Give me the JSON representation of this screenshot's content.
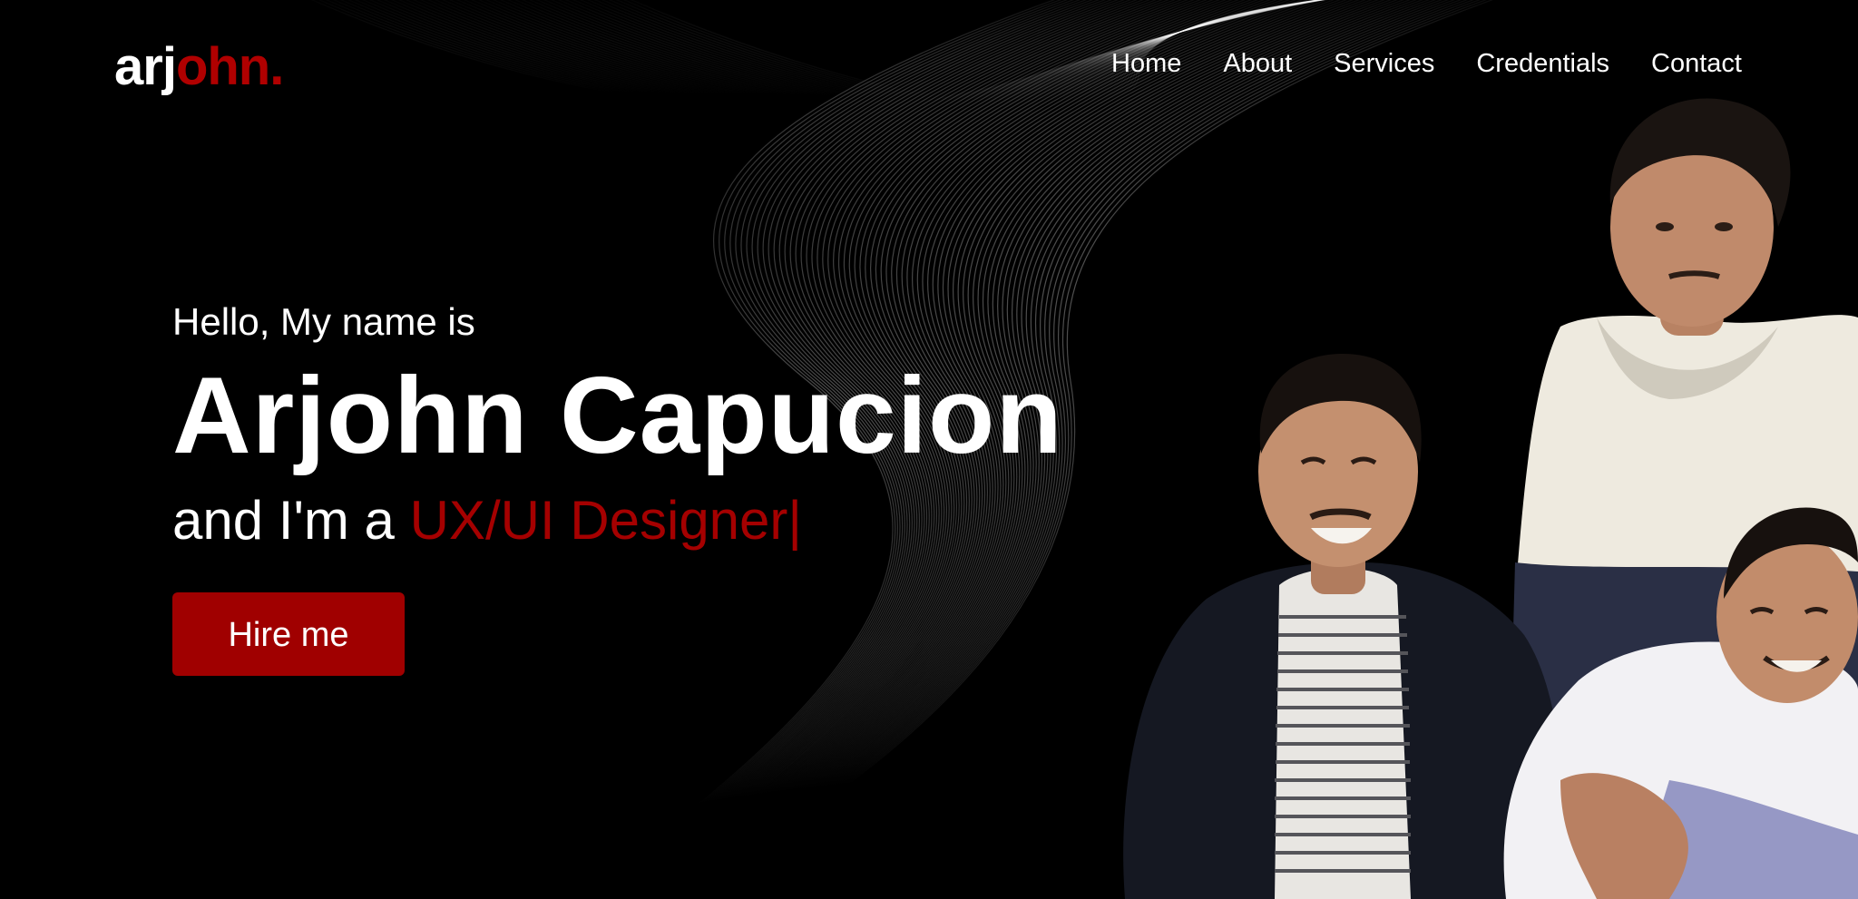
{
  "header": {
    "logo_part1": "arj",
    "logo_part2": "ohn."
  },
  "nav": {
    "items": [
      {
        "label": "Home"
      },
      {
        "label": "About"
      },
      {
        "label": "Services"
      },
      {
        "label": "Credentials"
      },
      {
        "label": "Contact"
      }
    ]
  },
  "hero": {
    "greeting": "Hello, My name is",
    "name": "Arjohn Capucion",
    "role_prefix": "and I'm a ",
    "role": "UX/UI Designer|",
    "cta_label": "Hire me"
  },
  "colors": {
    "background": "#000000",
    "accent": "#a00000",
    "text": "#ffffff"
  }
}
